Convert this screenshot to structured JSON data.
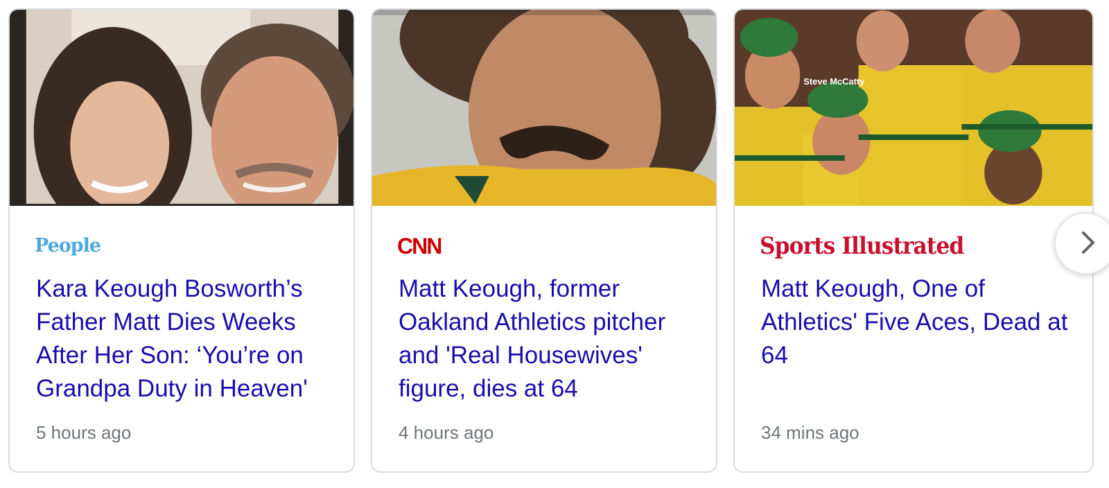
{
  "cards": [
    {
      "source": "People",
      "headline": "Kara Keough Bosworth’s Father Matt Dies Weeks After Her Son: ‘You’re on Grandpa Duty in Heaven'",
      "time": "5 hours ago"
    },
    {
      "source": "CNN",
      "headline": "Matt Keough, former Oakland Athletics pitcher and 'Real Housewives' figure, dies at 64",
      "time": "4 hours ago"
    },
    {
      "source": "Sports Illustrated",
      "headline": "Matt Keough, One of Athletics' Five Aces, Dead at 64",
      "time": "34 mins ago",
      "thumbnail_caption": "Steve McCatty"
    }
  ],
  "next_button": {
    "icon": "chevron-right-icon"
  },
  "colors": {
    "headline": "#1a0dab",
    "timestamp": "#70757a",
    "border": "#dadce0",
    "people_brand": "#4ea8dc",
    "cnn_brand": "#cc0000",
    "si_brand": "#c8102e"
  }
}
